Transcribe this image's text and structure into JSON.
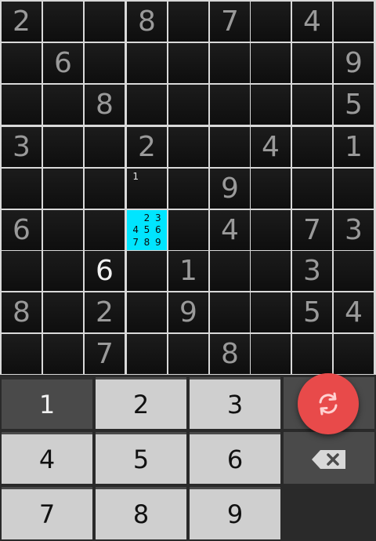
{
  "board": {
    "givens": [
      [
        "2",
        "",
        "",
        "8",
        "",
        "7",
        "",
        "4",
        ""
      ],
      [
        "",
        "6",
        "",
        "",
        "",
        "",
        "",
        "",
        "9"
      ],
      [
        "",
        "",
        "8",
        "",
        "",
        "",
        "",
        "",
        "5"
      ],
      [
        "3",
        "",
        "",
        "2",
        "",
        "",
        "4",
        "",
        "1"
      ],
      [
        "",
        "",
        "",
        "",
        "",
        "9",
        "",
        "",
        ""
      ],
      [
        "6",
        "",
        "",
        "",
        "",
        "4",
        "",
        "7",
        "3"
      ],
      [
        "",
        "",
        "",
        "",
        "1",
        "",
        "",
        "3",
        ""
      ],
      [
        "8",
        "",
        "2",
        "",
        "9",
        "",
        "",
        "5",
        "4"
      ],
      [
        "",
        "",
        "7",
        "",
        "",
        "8",
        "",
        "",
        ""
      ]
    ],
    "user_entries": [
      {
        "row": 6,
        "col": 2,
        "value": "6"
      }
    ],
    "pencil_marks": [
      {
        "row": 4,
        "col": 3,
        "marks": [
          "1",
          "",
          "",
          "",
          "",
          "",
          "",
          "",
          ""
        ]
      },
      {
        "row": 5,
        "col": 3,
        "marks": [
          "",
          "2",
          "3",
          "4",
          "5",
          "6",
          "7",
          "8",
          "9"
        ]
      }
    ],
    "selected_cell": {
      "row": 5,
      "col": 3
    },
    "colors": {
      "given_digit": "#9a9a9a",
      "user_digit": "#f2f2f2",
      "selected_cell": "#00e5ff",
      "grid_lines": "#d9d9d9",
      "cell_background": "#141414"
    }
  },
  "keypad": {
    "digits": [
      "1",
      "2",
      "3",
      "4",
      "5",
      "6",
      "7",
      "8",
      "9"
    ],
    "active_digit": "1",
    "delete_icon": "backspace-icon",
    "refresh_icon": "refresh-icon",
    "colors": {
      "key_light": "#cfcfcf",
      "key_dark": "#4a4a4a",
      "fab": "#e84a4a"
    }
  }
}
